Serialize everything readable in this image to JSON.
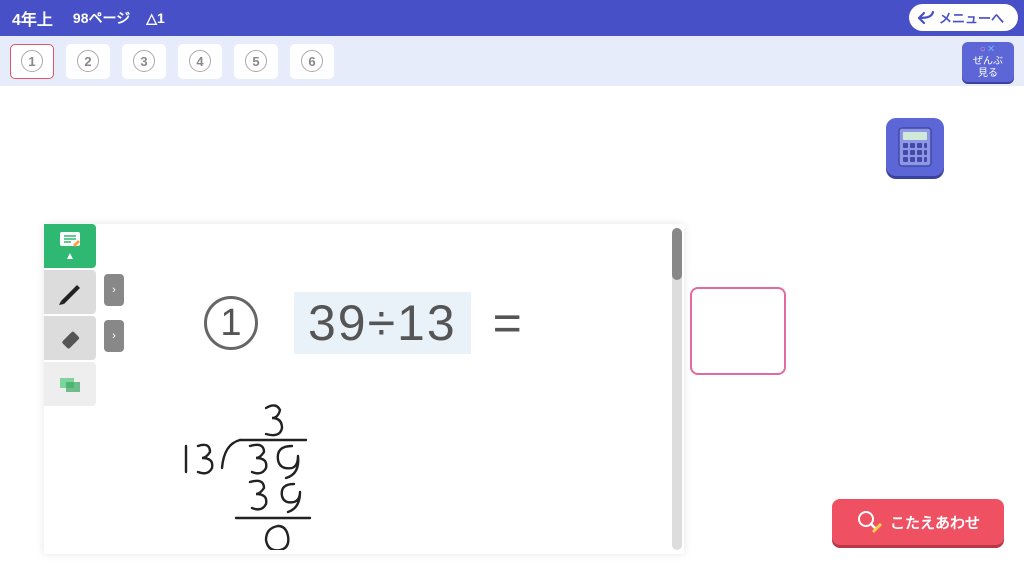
{
  "header": {
    "grade": "4年上",
    "page": "98ページ",
    "diff": "△1",
    "menu": "メニューへ"
  },
  "tabs": {
    "items": [
      "1",
      "2",
      "3",
      "4",
      "5",
      "6"
    ],
    "active": 0
  },
  "zenbu": {
    "line1": "ぜんぶ",
    "line2": "見る"
  },
  "problem": {
    "number": "1",
    "expression": "39÷13",
    "equals": "="
  },
  "handwriting": {
    "divisor": "13",
    "dividend": "39",
    "quotient": "3",
    "sub1": "39",
    "remainder": "0"
  },
  "check_button": "こたえあわせ"
}
